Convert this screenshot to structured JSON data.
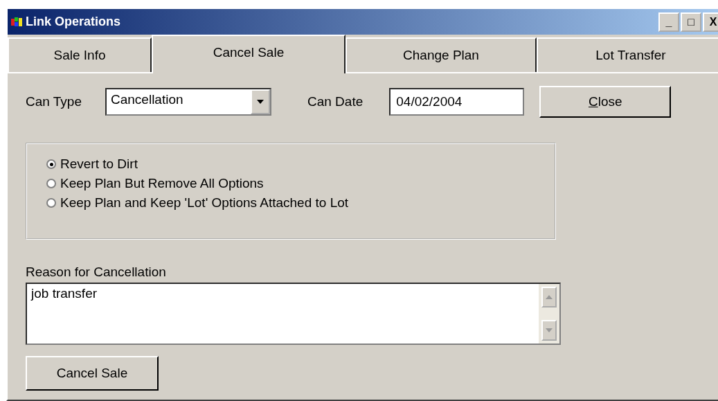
{
  "window": {
    "title": "Link Operations",
    "controls": [
      "_",
      "□",
      "X"
    ]
  },
  "tabs": [
    {
      "label": "Sale Info",
      "selected": false
    },
    {
      "label": "Cancel Sale",
      "selected": true
    },
    {
      "label": "Change Plan",
      "selected": false
    },
    {
      "label": "Lot Transfer",
      "selected": false
    }
  ],
  "can_type": {
    "label": "Can Type",
    "value": "Cancellation"
  },
  "can_date": {
    "label": "Can Date",
    "value": "04/02/2004"
  },
  "close_button": "Close",
  "options": [
    {
      "label": "Revert to Dirt",
      "selected": true
    },
    {
      "label": "Keep Plan But Remove All Options",
      "selected": false
    },
    {
      "label": "Keep Plan and Keep 'Lot' Options Attached to Lot",
      "selected": false
    }
  ],
  "reason": {
    "label": "Reason for Cancellation",
    "value": "job transfer"
  },
  "cancel_button": "Cancel Sale"
}
